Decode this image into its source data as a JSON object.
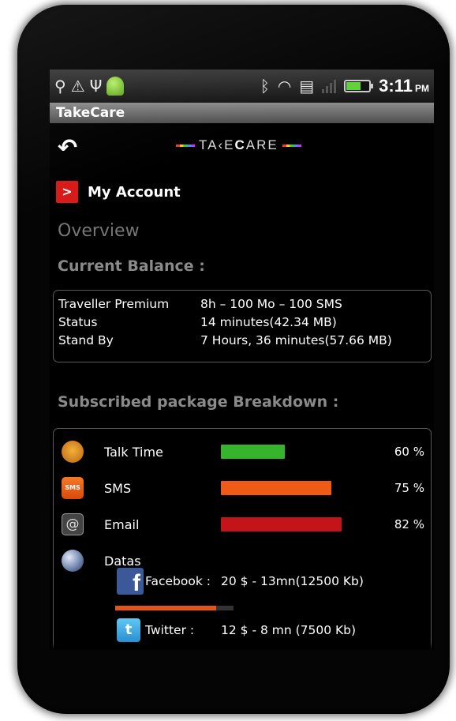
{
  "status_bar": {
    "time": "3:11",
    "ampm": "PM",
    "left_icons": [
      "location-icon",
      "warning-icon",
      "usb-icon",
      "android-icon"
    ],
    "right_icons": [
      "bluetooth-icon",
      "wifi-icon",
      "sync-icon",
      "signal-icon",
      "battery-icon"
    ]
  },
  "app": {
    "title": "TakeCare",
    "logo_left": "TA",
    "logo_mid": "K",
    "logo_care": "C",
    "logo_rest": "ARE"
  },
  "account": {
    "button_glyph": ">",
    "label": "My Account"
  },
  "overview_label": "Overview",
  "balance": {
    "title": "Current Balance :",
    "rows": [
      {
        "key": "Traveller Premium",
        "value": "8h – 100 Mo – 100 SMS"
      },
      {
        "key": "Status",
        "value": "14 minutes(42.34 MB)"
      },
      {
        "key": "Stand By",
        "value": "7 Hours, 36 minutes(57.66 MB)"
      }
    ]
  },
  "breakdown": {
    "title": "Subscribed package Breakdown :",
    "items": [
      {
        "label": "Talk Time",
        "percent_text": "60 %",
        "fill": 0.52,
        "color": "#36b52c",
        "icon": "talk-bubble-icon"
      },
      {
        "label": "SMS",
        "percent_text": "75 %",
        "fill": 0.9,
        "color": "#ef5a16",
        "icon": "sms-icon"
      },
      {
        "label": "Email",
        "percent_text": "82 %",
        "fill": 0.98,
        "color": "#c4141a",
        "icon": "email-at-icon"
      },
      {
        "label": "Datas",
        "icon": "globe-icon"
      }
    ],
    "data_items": [
      {
        "name": "Facebook :",
        "detail": "20 $ - 13mn(12500 Kb)",
        "icon": "facebook-icon",
        "glyph": "f",
        "usage": 0.85
      },
      {
        "name": "Twitter :",
        "detail": "12 $ - 8 mn (7500 Kb)",
        "icon": "twitter-icon",
        "glyph": "t"
      }
    ]
  },
  "colors": {
    "background": "#000000",
    "titlebar": "#6a6a6a",
    "accent_red": "#d71a1a",
    "section_title": "#8a8a8a"
  }
}
